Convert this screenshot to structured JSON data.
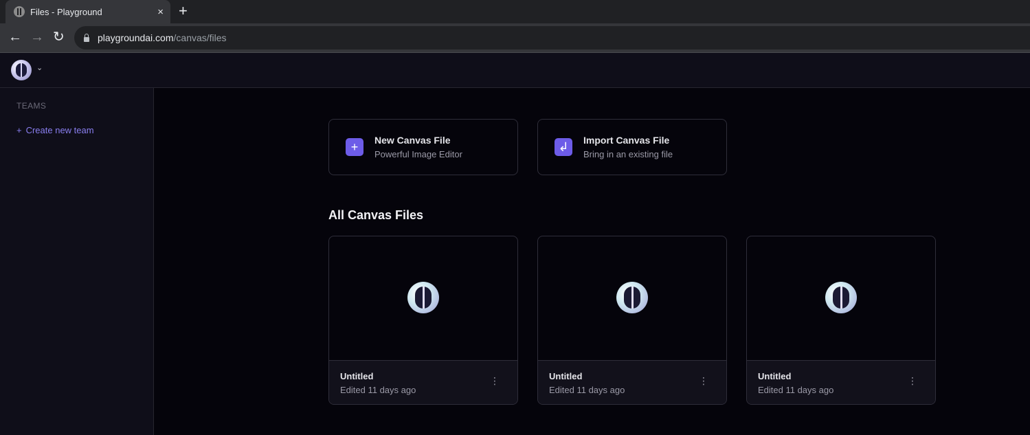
{
  "browser": {
    "tab_title": "Files - Playground",
    "tab_close": "×",
    "new_tab": "+",
    "url_domain": "playgroundai.com",
    "url_path": "/canvas/files",
    "back": "←",
    "forward": "→",
    "reload": "↻"
  },
  "header": {
    "chevron": "⌄"
  },
  "sidebar": {
    "teams_label": "TEAMS",
    "create_team_plus": "+",
    "create_team_label": "Create new team"
  },
  "actions": [
    {
      "icon": "plus-icon",
      "glyph": "+",
      "title": "New Canvas File",
      "subtitle": "Powerful Image Editor"
    },
    {
      "icon": "import-icon",
      "glyph": "↲",
      "title": "Import Canvas File",
      "subtitle": "Bring in an existing file"
    }
  ],
  "files_section": {
    "title": "All Canvas Files",
    "files": [
      {
        "name": "Untitled",
        "edited": "Edited 11 days ago",
        "more": "⋮"
      },
      {
        "name": "Untitled",
        "edited": "Edited 11 days ago",
        "more": "⋮"
      },
      {
        "name": "Untitled",
        "edited": "Edited 11 days ago",
        "more": "⋮"
      }
    ]
  },
  "colors": {
    "accent": "#6d5ce8",
    "link": "#8a7ff0",
    "background": "#05040b"
  }
}
